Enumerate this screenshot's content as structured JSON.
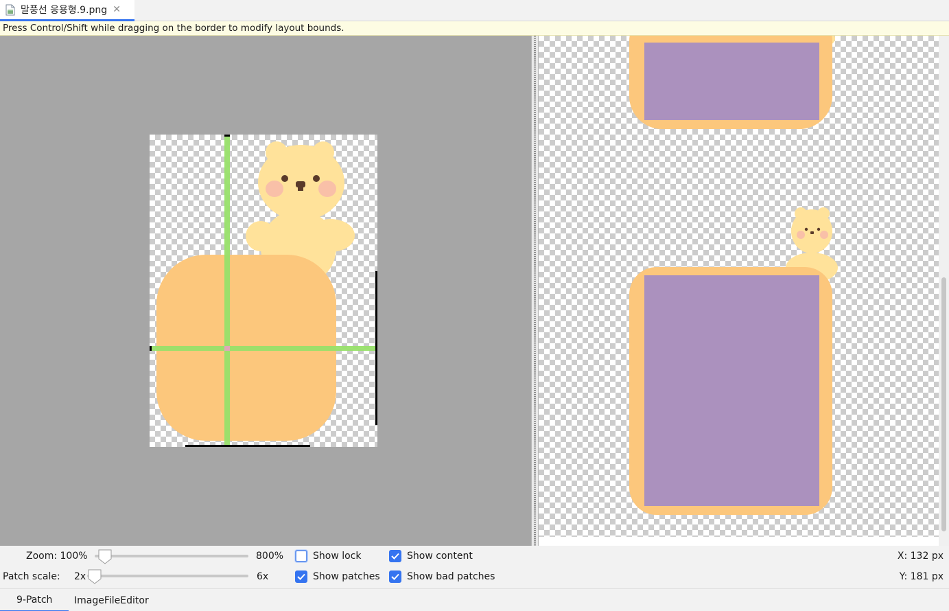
{
  "tab": {
    "file_name": "말풍선 응용형.9.png",
    "close_glyph": "✕",
    "icon": "image-file-icon"
  },
  "hint": "Press Control/Shift while dragging on the border to modify layout bounds.",
  "zoom": {
    "label": "Zoom: 100%",
    "max_label": "800%",
    "value_percent": 100
  },
  "patch_scale": {
    "label": "Patch scale:",
    "min_label": "2x",
    "max_label": "6x",
    "value": 2
  },
  "options": {
    "show_lock": {
      "label": "Show lock",
      "checked": false
    },
    "show_patches": {
      "label": "Show patches",
      "checked": true
    },
    "show_content": {
      "label": "Show content",
      "checked": true
    },
    "show_bad_patches": {
      "label": "Show bad patches",
      "checked": true
    }
  },
  "coords": {
    "x": "X: 132 px",
    "y": "Y: 181 px"
  },
  "bottom_tabs": [
    {
      "label": "9-Patch",
      "active": true
    },
    {
      "label": "ImageFileEditor",
      "active": false
    }
  ],
  "colors": {
    "accent": "#3574f0",
    "bubble": "#fcc77c",
    "content": "#ab91be",
    "bear": "#ffe29a",
    "cheek": "#f9c0a8",
    "patch_line": "#98e06a"
  }
}
